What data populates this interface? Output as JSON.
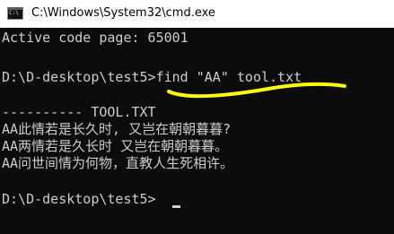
{
  "window": {
    "title": "C:\\Windows\\System32\\cmd.exe",
    "icon": "console-icon",
    "icon_text": "C:\\"
  },
  "console": {
    "lines": [
      "Active code page: 65001",
      "",
      "D:\\D-desktop\\test5>find \"AA\" tool.txt",
      "",
      "---------- TOOL.TXT",
      "AA此情若是长久时, 又岂在朝朝暮暮?",
      "AA两情若是久长时 又岂在朝朝暮暮。",
      "AA问世间情为何物，直教人生死相许。",
      "",
      "D:\\D-desktop\\test5>"
    ]
  },
  "colors": {
    "console_background": "#0c0c0c",
    "console_text": "#cccccc",
    "titlebar_background": "#ffffff",
    "highlight_underline": "#ffff00"
  }
}
